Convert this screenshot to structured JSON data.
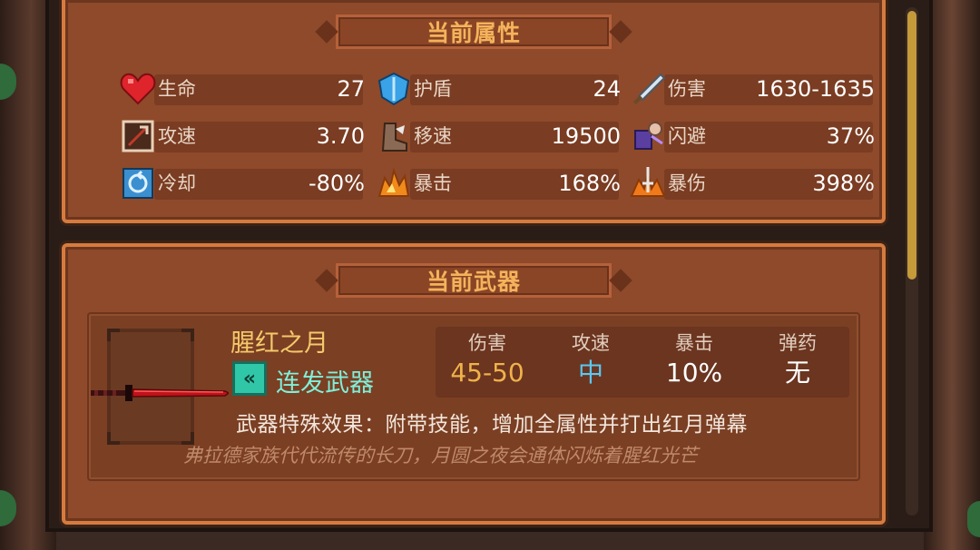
{
  "attributes": {
    "title": "当前属性",
    "stats": [
      {
        "label": "生命",
        "value": "27",
        "icon": "heart-icon"
      },
      {
        "label": "护盾",
        "value": "24",
        "icon": "shield-icon"
      },
      {
        "label": "伤害",
        "value": "1630-1635",
        "icon": "sword-icon"
      },
      {
        "label": "攻速",
        "value": "3.70",
        "icon": "attack-speed-icon"
      },
      {
        "label": "移速",
        "value": "19500",
        "icon": "boot-icon"
      },
      {
        "label": "闪避",
        "value": "37%",
        "icon": "dodge-icon"
      },
      {
        "label": "冷却",
        "value": "-80%",
        "icon": "cooldown-icon"
      },
      {
        "label": "暴击",
        "value": "168%",
        "icon": "crit-icon"
      },
      {
        "label": "暴伤",
        "value": "398%",
        "icon": "crit-damage-icon"
      }
    ]
  },
  "weapon": {
    "title": "当前武器",
    "name": "腥红之月",
    "type": "连发武器",
    "stats": [
      {
        "label": "伤害",
        "value": "45-50",
        "color": "#f0b24a"
      },
      {
        "label": "攻速",
        "value": "中",
        "color": "#5cc8f0"
      },
      {
        "label": "暴击",
        "value": "10%",
        "color": "#ffffff"
      },
      {
        "label": "弹药",
        "value": "无",
        "color": "#ffffff"
      }
    ],
    "special": "武器特殊效果：附带技能，增加全属性并打出红月弹幕",
    "lore": "弗拉德家族代代流传的长刀，月圆之夜会通体闪烁着腥红光芒"
  }
}
